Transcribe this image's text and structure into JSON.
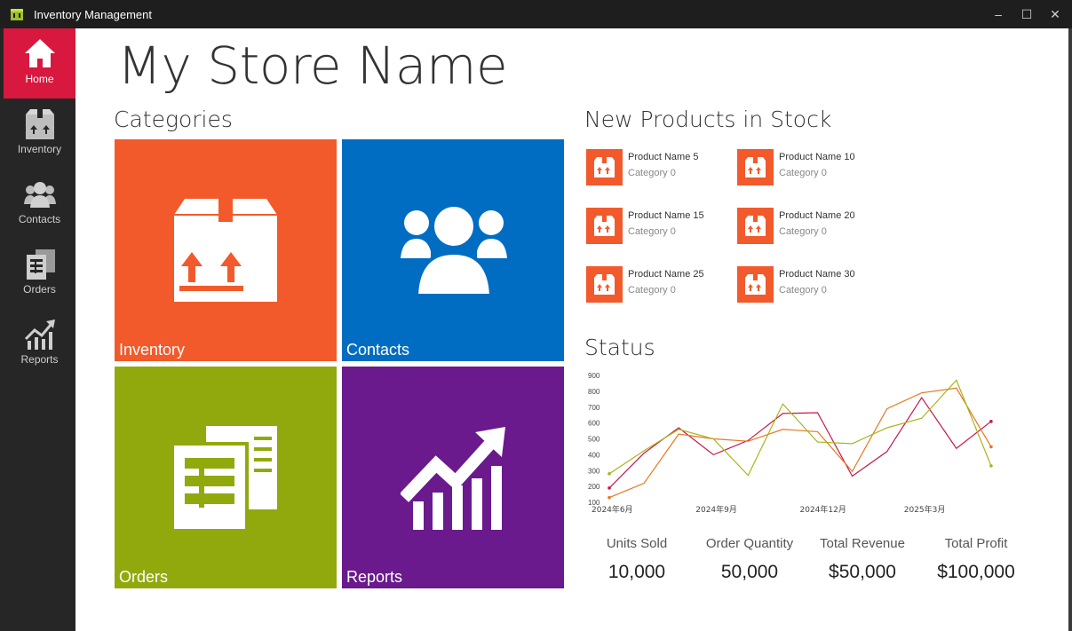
{
  "window": {
    "title": "Inventory Management"
  },
  "nav": [
    {
      "label": "Home",
      "icon": "home-icon",
      "active": true
    },
    {
      "label": "Inventory",
      "icon": "box-icon",
      "active": false
    },
    {
      "label": "Contacts",
      "icon": "people-icon",
      "active": false
    },
    {
      "label": "Orders",
      "icon": "orders-icon",
      "active": false
    },
    {
      "label": "Reports",
      "icon": "chart-icon",
      "active": false
    }
  ],
  "store": {
    "name": "My Store Name"
  },
  "sections": {
    "categories": "Categories",
    "new_products": "New Products in Stock",
    "status": "Status"
  },
  "tiles": [
    {
      "label": "Inventory",
      "color": "#f25a2c",
      "icon": "box-icon"
    },
    {
      "label": "Contacts",
      "color": "#006dc2",
      "icon": "people-icon"
    },
    {
      "label": "Orders",
      "color": "#91a90d",
      "icon": "orders-icon"
    },
    {
      "label": "Reports",
      "color": "#6a1a8c",
      "icon": "chart-icon"
    }
  ],
  "products": [
    {
      "name": "Product Name 5",
      "category": "Category 0"
    },
    {
      "name": "Product Name 10",
      "category": "Category 0"
    },
    {
      "name": "Product Name 15",
      "category": "Category 0"
    },
    {
      "name": "Product Name 20",
      "category": "Category 0"
    },
    {
      "name": "Product Name 25",
      "category": "Category 0"
    },
    {
      "name": "Product Name 30",
      "category": "Category 0"
    }
  ],
  "chart_data": {
    "type": "line",
    "ylim": [
      100,
      900
    ],
    "yticks": [
      100,
      200,
      300,
      400,
      500,
      600,
      700,
      800,
      900
    ],
    "x": [
      "2024-06",
      "2024-07",
      "2024-08",
      "2024-09",
      "2024-10",
      "2024-11",
      "2024-12",
      "2025-01",
      "2025-02",
      "2025-03",
      "2025-04",
      "2025-05",
      "2025-06"
    ],
    "xtick_labels": [
      {
        "x": "2024-06",
        "label": "2024年6月"
      },
      {
        "x": "2024-09",
        "label": "2024年9月"
      },
      {
        "x": "2024-12",
        "label": "2024年12月"
      },
      {
        "x": "2025-03",
        "label": "2025年3月"
      }
    ],
    "series": [
      {
        "color": "#c8164a",
        "values": [
          190,
          410,
          570,
          400,
          490,
          660,
          665,
          265,
          420,
          760,
          440,
          610,
          null
        ]
      },
      {
        "color": "#e8761f",
        "values": [
          130,
          220,
          530,
          500,
          485,
          560,
          545,
          295,
          690,
          790,
          820,
          450,
          null
        ]
      },
      {
        "color": "#a8b51a",
        "values": [
          280,
          425,
          560,
          500,
          270,
          720,
          480,
          470,
          570,
          630,
          870,
          330,
          null
        ]
      }
    ],
    "grid": false
  },
  "stats": [
    {
      "label": "Units Sold",
      "value": "10,000"
    },
    {
      "label": "Order Quantity",
      "value": "50,000"
    },
    {
      "label": "Total Revenue",
      "value": "$50,000"
    },
    {
      "label": "Total Profit",
      "value": "$100,000"
    }
  ]
}
